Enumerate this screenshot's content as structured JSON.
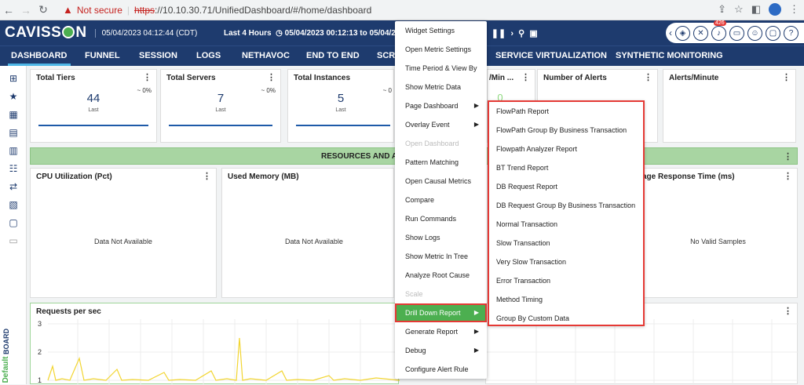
{
  "browser": {
    "not_secure": "Not secure",
    "url_https": "https",
    "url_rest": "://10.10.30.71/UnifiedDashboard/#/home/dashboard"
  },
  "header": {
    "logo_left": "CAVISS",
    "logo_right": "N",
    "date": "05/04/2023 04:12:44 (CDT)",
    "period": "Last 4 Hours",
    "period_range": "05/04/2023 00:12:13 to 05/04/2023 0",
    "notification_count": "426"
  },
  "nav": {
    "tabs": [
      "DASHBOARD",
      "FUNNEL",
      "SESSION",
      "LOGS",
      "NETHAVOC",
      "END TO END",
      "SCRI",
      "SERVICE VIRTUALIZATION",
      "SYNTHETIC MONITORING"
    ]
  },
  "sidebar": {
    "vertical_label_top": "Default",
    "vertical_label_bottom": "BOARD"
  },
  "tiles": [
    {
      "title": "Total Tiers",
      "value": "44",
      "sub": "Last",
      "pct": "~ 0%"
    },
    {
      "title": "Total Servers",
      "value": "7",
      "sub": "Last",
      "pct": "~ 0%"
    },
    {
      "title": "Total Instances",
      "value": "5",
      "sub": "Last",
      "pct": "~ 0"
    },
    {
      "title": "/Min ...",
      "value": "0",
      "sub": "",
      "pct": ""
    },
    {
      "title": "Number of Alerts",
      "value": "",
      "sub": "",
      "pct": ""
    },
    {
      "title": "Alerts/Minute",
      "value": "",
      "sub": "",
      "pct": ""
    }
  ],
  "banner": "RESOURCES AND A",
  "panels": [
    {
      "title": "CPU Utilization (Pct)",
      "message": "Data Not Available"
    },
    {
      "title": "Used Memory (MB)",
      "message": "Data Not Available"
    },
    {
      "title": "age Response Time (ms)",
      "message": "No Valid Samples"
    }
  ],
  "chart": {
    "title": "Requests per sec",
    "y_ticks": [
      "3",
      "2",
      "1"
    ]
  },
  "context_menu": {
    "items": [
      {
        "label": "Widget Settings",
        "state": "normal",
        "arrow": ""
      },
      {
        "label": "Open Metric Settings",
        "state": "normal",
        "arrow": ""
      },
      {
        "label": "Time Period & View By",
        "state": "normal",
        "arrow": ""
      },
      {
        "label": "Show Metric Data",
        "state": "normal",
        "arrow": ""
      },
      {
        "label": "Page Dashboard",
        "state": "normal",
        "arrow": "▶"
      },
      {
        "label": "Overlay Event",
        "state": "normal",
        "arrow": "▶"
      },
      {
        "label": "Open Dashboard",
        "state": "disabled",
        "arrow": ""
      },
      {
        "label": "Pattern Matching",
        "state": "normal",
        "arrow": ""
      },
      {
        "label": "Open Causal Metrics",
        "state": "normal",
        "arrow": ""
      },
      {
        "label": "Compare",
        "state": "normal",
        "arrow": ""
      },
      {
        "label": "Run Commands",
        "state": "normal",
        "arrow": ""
      },
      {
        "label": "Show Logs",
        "state": "normal",
        "arrow": ""
      },
      {
        "label": "Show Metric In Tree",
        "state": "normal",
        "arrow": ""
      },
      {
        "label": "Analyze Root Cause",
        "state": "normal",
        "arrow": ""
      },
      {
        "label": "Scale",
        "state": "disabled",
        "arrow": ""
      },
      {
        "label": "Drill Down Report",
        "state": "selected",
        "arrow": "▶"
      },
      {
        "label": "Generate Report",
        "state": "normal",
        "arrow": "▶"
      },
      {
        "label": "Debug",
        "state": "normal",
        "arrow": "▶"
      },
      {
        "label": "Configure Alert Rule",
        "state": "normal",
        "arrow": ""
      }
    ]
  },
  "submenu": {
    "items": [
      "FlowPath Report",
      "FlowPath Group By Business Transaction",
      "Flowpath Analyzer Report",
      "BT Trend Report",
      "DB Request Report",
      "DB Request Group By Business Transaction",
      "Normal Transaction",
      "Slow Transaction",
      "Very Slow Transaction",
      "Error Transaction",
      "Method Timing",
      "Group By Custom Data"
    ]
  },
  "colors": {
    "header_bg": "#1e3b6e",
    "accent_green": "#4caf50",
    "highlight_red": "#e53935",
    "banner_green": "#a8d5a2",
    "chart_line": "#f2d531"
  }
}
